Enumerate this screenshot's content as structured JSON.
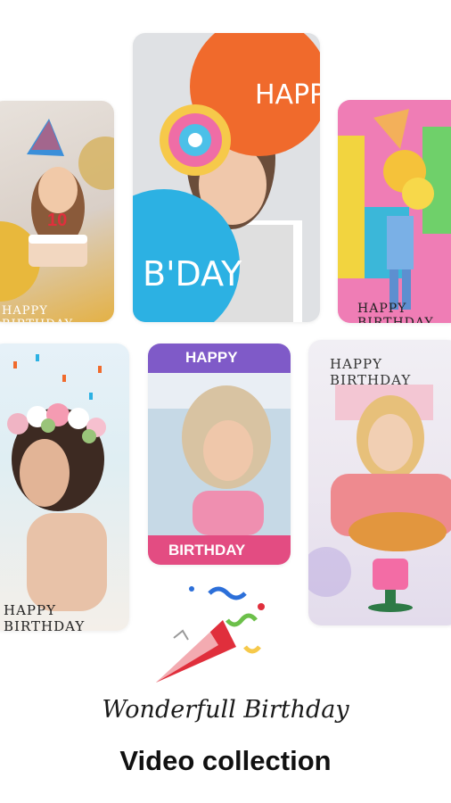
{
  "cards": [
    {
      "caption": "HAPPY BIRTHDAY",
      "cake_number": "10"
    },
    {
      "caption_top": "HAPPY",
      "caption_bottom": "B'DAY"
    },
    {
      "caption": "HAPPY BIRTHDAY"
    },
    {
      "caption": "HAPPY BIRTHDAY"
    },
    {
      "caption_top": "HAPPY",
      "caption_bottom": "BIRTHDAY"
    },
    {
      "caption": "HAPPY BIRTHDAY"
    }
  ],
  "footer": {
    "script_title": "Wonderfull Birthday",
    "title": "Video collection"
  },
  "colors": {
    "orange_bubble": "#f06a2c",
    "blue_bubble": "#2cb1e3",
    "purple_band": "#7f5ac8",
    "pink_band": "#e34c82",
    "gold": "#e4b145"
  }
}
